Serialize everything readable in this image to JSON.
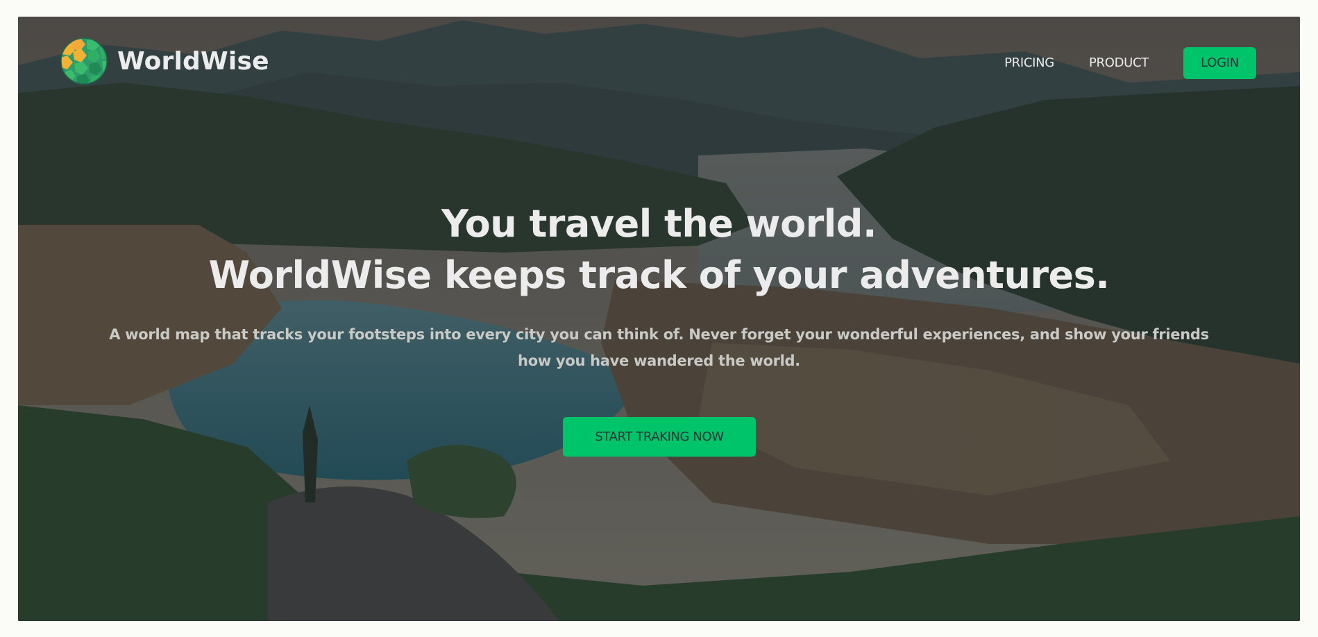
{
  "brand": {
    "logo_icon": "worldwise-globe-logo-icon",
    "name": "WorldWise"
  },
  "nav": {
    "links": [
      {
        "label": "PRICING"
      },
      {
        "label": "PRODUCT"
      }
    ],
    "login_label": "LOGIN"
  },
  "hero": {
    "background": "landscape-photo-coastal-town-mountains",
    "headline_line_1": "You travel the world.",
    "headline_line_2": "WorldWise keeps track of your adventures.",
    "subtext_line_1": "A world map that tracks your footsteps into every city you can think of. Never forget your wonderful experiences, and show your friends",
    "subtext_line_2": "how you have wandered the world.",
    "cta_label": "START TRAKING NOW"
  },
  "colors": {
    "accent": "#00c46a",
    "overlay": "#242a2e",
    "text_light": "#ececec",
    "text_muted": "#c9c9c6",
    "button_text": "#2d3439",
    "page_bg": "#fbfbf7"
  }
}
